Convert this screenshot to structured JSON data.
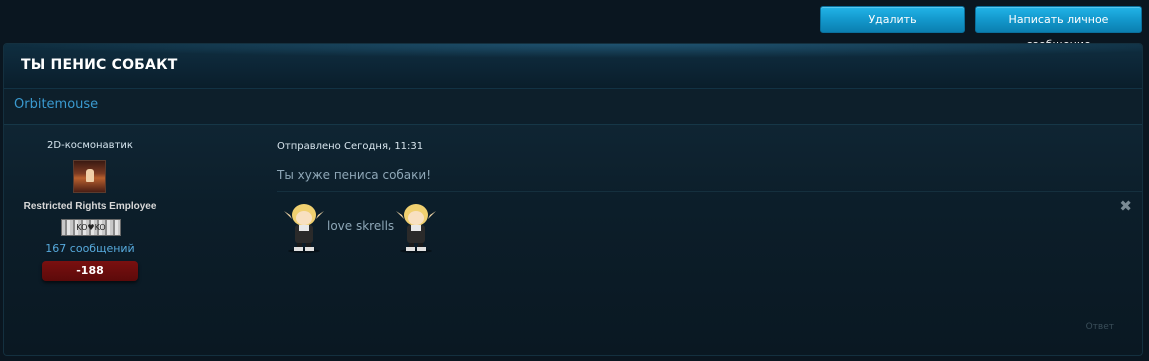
{
  "toolbar": {
    "delete_label": "Удалить",
    "pm_label": "Написать личное сообщение"
  },
  "thread": {
    "title": "ТЫ ПЕНИС СОБАКТ"
  },
  "post": {
    "author": "Orbitemouse",
    "user_title": "2D-космонавтик",
    "rank": "Restricted Rights Employee",
    "rank_image_text": "KO♥KO",
    "post_count": "167 сообщений",
    "reputation": "-188",
    "sent_label": "Отправлено Сегодня, 11:31",
    "message": "Ты хуже пениса собаки!",
    "signature_text": "love skrells",
    "close_glyph": "✖",
    "reply_label": "Ответ",
    "reputation_color": "#6a0d0d",
    "accent_color": "#1398cc",
    "link_color": "#3a9ad0"
  }
}
